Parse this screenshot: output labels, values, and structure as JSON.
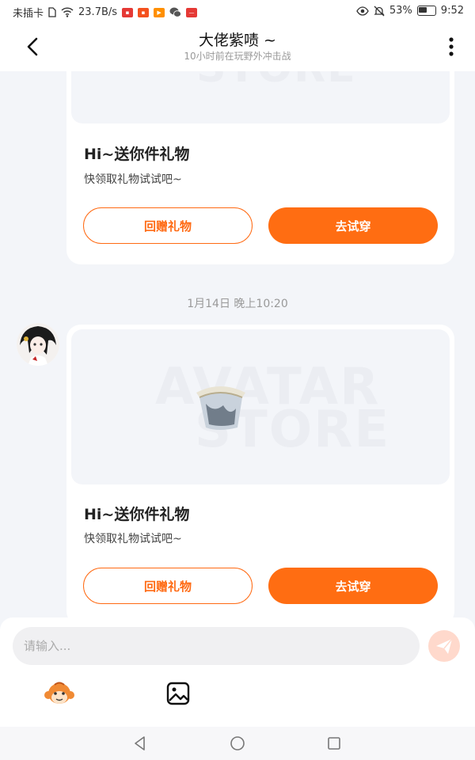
{
  "status_bar": {
    "carrier": "未插卡",
    "speed": "23.7B/s",
    "battery": "53%",
    "time": "9:52"
  },
  "header": {
    "title": "大佬紫啧 ~",
    "subtitle": "10小时前在玩野外冲击战"
  },
  "messages": [
    {
      "title": "Hi~送你件礼物",
      "desc": "快领取礼物试试吧~",
      "btn_return": "回赠礼物",
      "btn_try": "去试穿"
    },
    {
      "timestamp": "1月14日 晚上10:20",
      "watermark_line1": "AVATAR",
      "watermark_line2": "STORE",
      "title": "Hi~送你件礼物",
      "desc": "快领取礼物试试吧~",
      "btn_return": "回赠礼物",
      "btn_try": "去试穿"
    }
  ],
  "input_bar": {
    "placeholder": "请输入..."
  },
  "colors": {
    "accent": "#ff6d12",
    "background": "#f3f5f9",
    "send_disabled": "#ffd9cc"
  },
  "icons": {
    "back": "chevron-left-icon",
    "more": "more-vertical-icon",
    "send": "paper-plane-icon",
    "sticker": "monkey-face-icon",
    "image": "image-icon"
  }
}
